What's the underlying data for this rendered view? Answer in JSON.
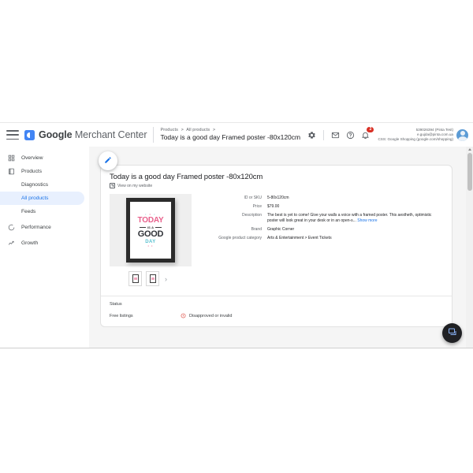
{
  "app": {
    "brand_google": "Google",
    "brand_rest": " Merchant Center",
    "logo_icon": "merchant-center-logo"
  },
  "breadcrumb": {
    "level1": "Products",
    "sep1": ">",
    "level2": "All products",
    "sep2": ">",
    "title": "Today is a good day Framed poster -80x120cm"
  },
  "topbar": {
    "menu_icon": "hamburger-menu-icon",
    "settings_icon": "gear-icon",
    "mail_icon": "mail-icon",
    "help_icon": "help-icon",
    "notifications_icon": "bell-icon",
    "notification_count": "2",
    "avatar_icon": "user-avatar"
  },
  "account": {
    "line1": "539026394 (Pinta Test)",
    "line2": "e.gujda@pinta.com.ua",
    "line3": "CSS: Google Shopping (google.com/shopping)"
  },
  "sidebar": {
    "items": [
      {
        "label": "Overview",
        "icon": "dashboard-icon",
        "sub": false,
        "active": false
      },
      {
        "label": "Products",
        "icon": "products-icon",
        "sub": false,
        "active": false
      },
      {
        "label": "Diagnostics",
        "icon": "",
        "sub": true,
        "active": false
      },
      {
        "label": "All products",
        "icon": "",
        "sub": true,
        "active": true
      },
      {
        "label": "Feeds",
        "icon": "",
        "sub": true,
        "active": false
      },
      {
        "label": "Performance",
        "icon": "performance-icon",
        "sub": false,
        "active": false
      },
      {
        "label": "Growth",
        "icon": "growth-icon",
        "sub": false,
        "active": false
      }
    ]
  },
  "fab": {
    "edit_icon": "pencil-edit-icon",
    "chat_icon": "chat-feedback-icon"
  },
  "product": {
    "title": "Today is a good day Framed poster -80x120cm",
    "view_link": "View on my website",
    "view_link_icon": "external-link-icon",
    "image_alt": "framed-poster-today-is-a-good-day",
    "poster_text": {
      "top_dots": "• • •",
      "line1": "TODAY",
      "line2": "IS A",
      "line3": "GOOD",
      "line4": "DAY",
      "bottom_dots": "• • •"
    },
    "next_image_icon": "chevron-right-icon",
    "attributes": [
      {
        "label": "ID or SKU",
        "value": "5-80x120cm"
      },
      {
        "label": "Price",
        "value": "$79.00"
      },
      {
        "label": "Description",
        "value": "The best is yet to come! Give your walls a voice with a framed poster. This aestheth, optimistic poster will look great in your desk or in an open-s...",
        "more": "Show more"
      },
      {
        "label": "Brand",
        "value": "Graphic Corner"
      },
      {
        "label": "Google product category",
        "value": "Arts & Entertainment > Event Tickets"
      }
    ]
  },
  "status": {
    "heading": "Status",
    "rows": [
      {
        "key": "Free listings",
        "value": "Disapproved or invalid",
        "icon": "warning-icon",
        "color": "#d93025"
      }
    ]
  },
  "colors": {
    "accent": "#1a73e8",
    "selected_bg": "#e8f0fe",
    "error": "#d93025",
    "page_bg": "#f5f5f5"
  }
}
